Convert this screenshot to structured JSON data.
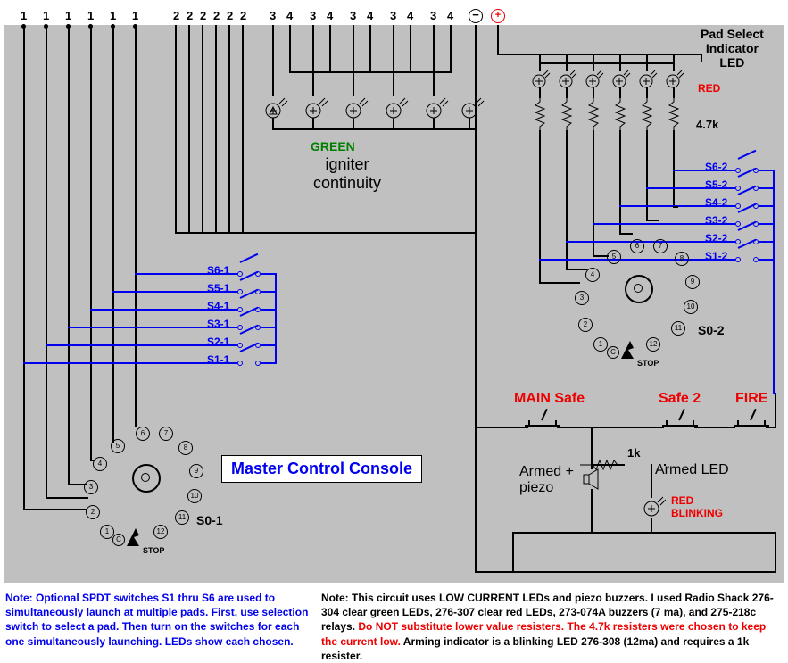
{
  "title": "Master Control Console",
  "top_labels": [
    "1",
    "1",
    "1",
    "1",
    "1",
    "1",
    "2",
    "2",
    "2",
    "2",
    "2",
    "2",
    "3",
    "4",
    "3",
    "4",
    "3",
    "4",
    "3",
    "4",
    "3",
    "4",
    "3",
    "4"
  ],
  "polarity": {
    "minus": "−",
    "plus": "+"
  },
  "igniter": {
    "color_label": "GREEN",
    "text": "igniter\ncontinuity"
  },
  "pad_select": {
    "title": "Pad Select\nIndicator\nLED",
    "color_label": "RED",
    "resistor": "4.7k"
  },
  "switches_left": [
    "S6-1",
    "S5-1",
    "S4-1",
    "S3-1",
    "S2-1",
    "S1-1"
  ],
  "switches_right": [
    "S6-2",
    "S5-2",
    "S4-2",
    "S3-2",
    "S2-2",
    "S1-2"
  ],
  "rotary_left_label": "S0-1",
  "rotary_right_label": "S0-2",
  "stop_label": "STOP",
  "safety": {
    "main_safe": "MAIN Safe",
    "safe2": "Safe 2",
    "fire": "FIRE",
    "armed_piezo": "Armed +\npiezo",
    "armed_led": "Armed LED",
    "r1k": "1k",
    "blinking": "RED\nBLINKING"
  },
  "footnote_left": "Note: Optional SPDT switches S1 thru S6 are used to\nsimultaneously launch at multiple pads. First, use selection\nswitch to select a pad. Then turn on the switches for each\none simultaneously launching. LEDs show each chosen.",
  "footnote_right_plain_1": "Note:  This circuit uses LOW CURRENT LEDs and piezo buzzers.  I used Radio Shack\n276-304 clear green LEDs, 276-307 clear red LEDs, 273-074A buzzers (7 ma), and 275-218c\nrelays.  ",
  "footnote_right_red": "Do NOT substitute lower value resisters.  The 4.7k resisters were chosen to keep the\ncurrent low.",
  "footnote_right_plain_2": "  Arming indicator is a blinking LED 276-308 (12ma) and requires a 1k resister.",
  "pins": [
    "1",
    "2",
    "3",
    "4",
    "5",
    "6",
    "7",
    "8",
    "9",
    "10",
    "11",
    "12",
    "C"
  ]
}
